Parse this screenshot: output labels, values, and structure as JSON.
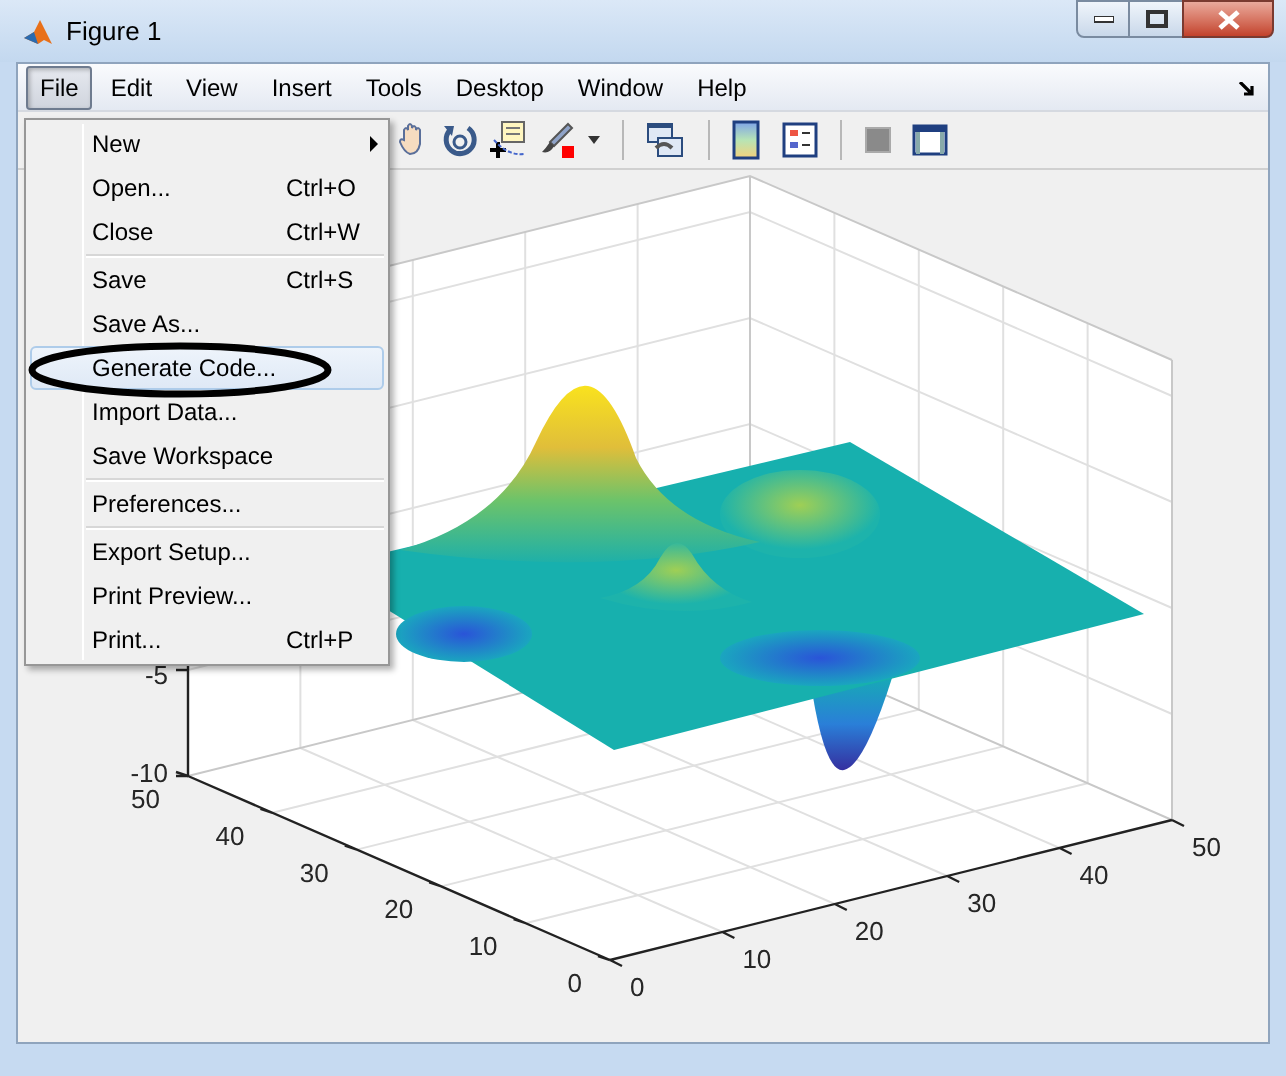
{
  "window": {
    "title": "Figure 1"
  },
  "menubar": [
    {
      "label": "File",
      "selected": true
    },
    {
      "label": "Edit",
      "selected": false
    },
    {
      "label": "View",
      "selected": false
    },
    {
      "label": "Insert",
      "selected": false
    },
    {
      "label": "Tools",
      "selected": false
    },
    {
      "label": "Desktop",
      "selected": false
    },
    {
      "label": "Window",
      "selected": false
    },
    {
      "label": "Help",
      "selected": false
    }
  ],
  "file_menu": {
    "groups": [
      [
        {
          "label": "New",
          "submenu": true,
          "selected": false
        },
        {
          "label": "Open...",
          "shortcut": "Ctrl+O",
          "selected": false
        },
        {
          "label": "Close",
          "shortcut": "Ctrl+W",
          "selected": false
        }
      ],
      [
        {
          "label": "Save",
          "shortcut": "Ctrl+S",
          "selected": false
        },
        {
          "label": "Save As...",
          "selected": false
        },
        {
          "label": "Generate Code...",
          "selected": true,
          "circled": true
        },
        {
          "label": "Import Data...",
          "selected": false
        },
        {
          "label": "Save Workspace",
          "selected": false
        }
      ],
      [
        {
          "label": "Preferences...",
          "selected": false
        }
      ],
      [
        {
          "label": "Export Setup...",
          "selected": false
        },
        {
          "label": "Print Preview...",
          "selected": false
        },
        {
          "label": "Print...",
          "shortcut": "Ctrl+P",
          "selected": false
        }
      ]
    ]
  },
  "axes": {
    "z_ticks": [
      "-5",
      "-10"
    ],
    "y_ticks": [
      "0",
      "10",
      "20",
      "30",
      "40",
      "50"
    ],
    "x_ticks": [
      "0",
      "10",
      "20",
      "30",
      "40",
      "50"
    ]
  }
}
